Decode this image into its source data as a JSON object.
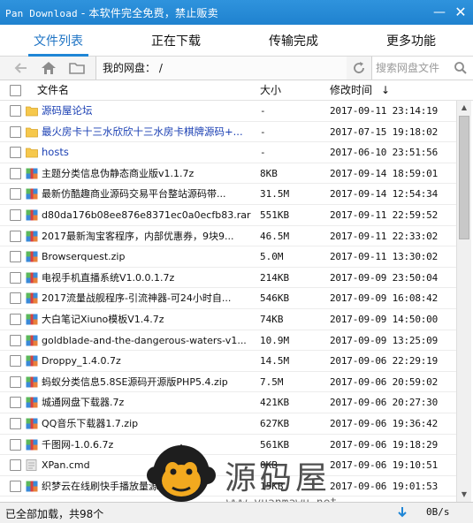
{
  "window": {
    "app_name": "Pan Download",
    "title_suffix": " - 本软件完全免费，禁止贩卖",
    "minimize_glyph": "—",
    "close_glyph": "✕"
  },
  "tabs": [
    {
      "label": "文件列表",
      "active": true
    },
    {
      "label": "正在下载",
      "active": false
    },
    {
      "label": "传输完成",
      "active": false
    },
    {
      "label": "更多功能",
      "active": false
    }
  ],
  "navbar": {
    "path": "我的网盘： /",
    "search_placeholder": "搜索网盘文件"
  },
  "table": {
    "headers": {
      "name": "文件名",
      "size": "大小",
      "mtime": "修改时间",
      "sort_glyph": "↓"
    },
    "rows": [
      {
        "name": "源码屋论坛",
        "size": "-",
        "time": "2017-09-11 23:14:19",
        "icon": "folder-icon",
        "dir": true
      },
      {
        "name": "最火房卡十三水欣欣十三水房卡棋牌源码+...",
        "size": "-",
        "time": "2017-07-15 19:18:02",
        "icon": "folder-icon",
        "dir": true
      },
      {
        "name": "hosts",
        "size": "-",
        "time": "2017-06-10 23:51:56",
        "icon": "folder-icon",
        "dir": true
      },
      {
        "name": "主题分类信息伪静态商业版v1.1.7z",
        "size": "8KB",
        "time": "2017-09-14 18:59:01",
        "icon": "archive-icon",
        "dir": false
      },
      {
        "name": "最新仿酷趣商业源码交易平台整站源码带...",
        "size": "31.5M",
        "time": "2017-09-14 12:54:34",
        "icon": "archive-icon",
        "dir": false
      },
      {
        "name": "d80da176b08ee876e8371ec0a0ecfb83.rar",
        "size": "551KB",
        "time": "2017-09-11 22:59:52",
        "icon": "archive-icon",
        "dir": false
      },
      {
        "name": "2017最新淘宝客程序，内部优惠券，9块9...",
        "size": "46.5M",
        "time": "2017-09-11 22:33:02",
        "icon": "archive-icon",
        "dir": false
      },
      {
        "name": "Browserquest.zip",
        "size": "5.0M",
        "time": "2017-09-11 13:30:02",
        "icon": "archive-icon",
        "dir": false
      },
      {
        "name": "电视手机直播系统V1.0.0.1.7z",
        "size": "214KB",
        "time": "2017-09-09 23:50:04",
        "icon": "archive-icon",
        "dir": false
      },
      {
        "name": "2017流量战舰程序-引流神器-可24小时自...",
        "size": "546KB",
        "time": "2017-09-09 16:08:42",
        "icon": "archive-icon",
        "dir": false
      },
      {
        "name": "大白笔记Xiuno模板V1.4.7z",
        "size": "74KB",
        "time": "2017-09-09 14:50:00",
        "icon": "archive-icon",
        "dir": false
      },
      {
        "name": "goldblade-and-the-dangerous-waters-v1...",
        "size": "10.9M",
        "time": "2017-09-09 13:25:09",
        "icon": "archive-icon",
        "dir": false
      },
      {
        "name": "Droppy_1.4.0.7z",
        "size": "14.5M",
        "time": "2017-09-06 22:29:19",
        "icon": "archive-icon",
        "dir": false
      },
      {
        "name": "蚂蚁分类信息5.8SE源码开源版PHP5.4.zip",
        "size": "7.5M",
        "time": "2017-09-06 20:59:02",
        "icon": "archive-icon",
        "dir": false
      },
      {
        "name": "城通网盘下载器.7z",
        "size": "421KB",
        "time": "2017-09-06 20:27:30",
        "icon": "archive-icon",
        "dir": false
      },
      {
        "name": "QQ音乐下载器1.7.zip",
        "size": "627KB",
        "time": "2017-09-06 19:36:42",
        "icon": "archive-icon",
        "dir": false
      },
      {
        "name": "千图网-1.0.6.7z",
        "size": "561KB",
        "time": "2017-09-06 19:18:29",
        "icon": "archive-icon",
        "dir": false
      },
      {
        "name": "XPan.cmd",
        "size": "0KB",
        "time": "2017-09-06 19:10:51",
        "icon": "file-icon",
        "dir": false
      },
      {
        "name": "织梦云在线刷快手播放量源码.zip",
        "size": "15KB",
        "time": "2017-09-06 19:01:53",
        "icon": "archive-icon",
        "dir": false
      }
    ]
  },
  "statusbar": {
    "text": "已全部加载，共98个",
    "speed": "0B/s"
  },
  "watermark": {
    "brand": "源码屋",
    "url": "www.yuanmawu.net"
  },
  "colors": {
    "titlebar": "#2185d0",
    "tab_active": "#1f74c4",
    "folder_link": "#1a3fb3",
    "folder_icon": "#f4c54a"
  }
}
